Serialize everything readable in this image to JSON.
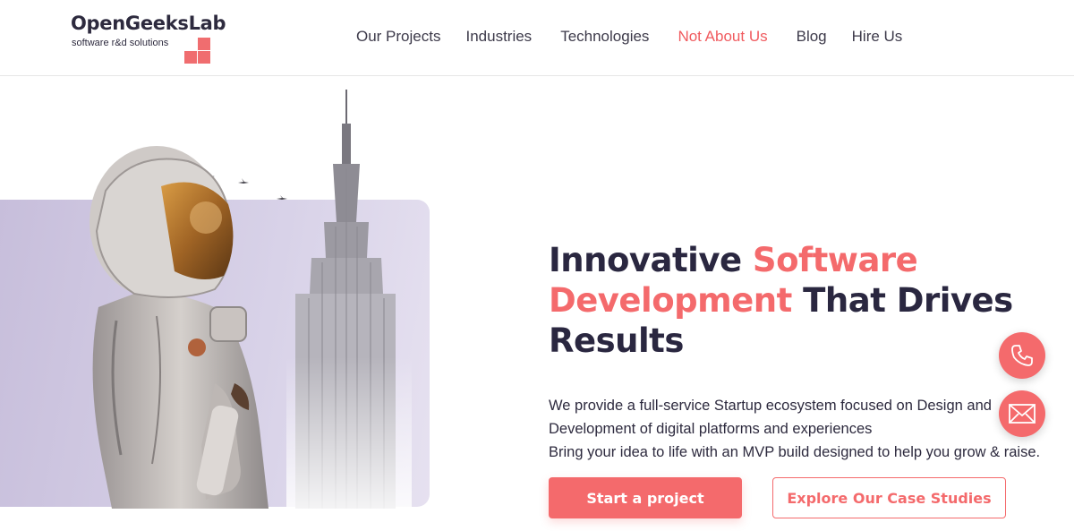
{
  "brand": {
    "name": "OpenGeeksLab",
    "tagline": "software r&d solutions",
    "color": "#f46a6c"
  },
  "nav": {
    "items": [
      {
        "label": "Our Projects"
      },
      {
        "label": "Industries"
      },
      {
        "label": "Technologies"
      },
      {
        "label": "Not About Us",
        "active": true
      },
      {
        "label": "Blog"
      },
      {
        "label": "Hire Us"
      }
    ]
  },
  "hero": {
    "headline": {
      "part1": "Innovative ",
      "accent1": "Software",
      "accent2": "Development",
      "part2": " That Drives",
      "part3": "Results"
    },
    "description": [
      "We provide a full-service Startup ecosystem focused on Design and",
      "Development of digital platforms and experiences",
      "Bring your idea to life with an MVP build designed to help you grow & raise."
    ],
    "primary_cta": "Start a project",
    "secondary_cta": "Explore Our Case Studies"
  },
  "floating": {
    "phone_icon": "phone-icon",
    "mail_icon": "mail-icon"
  }
}
